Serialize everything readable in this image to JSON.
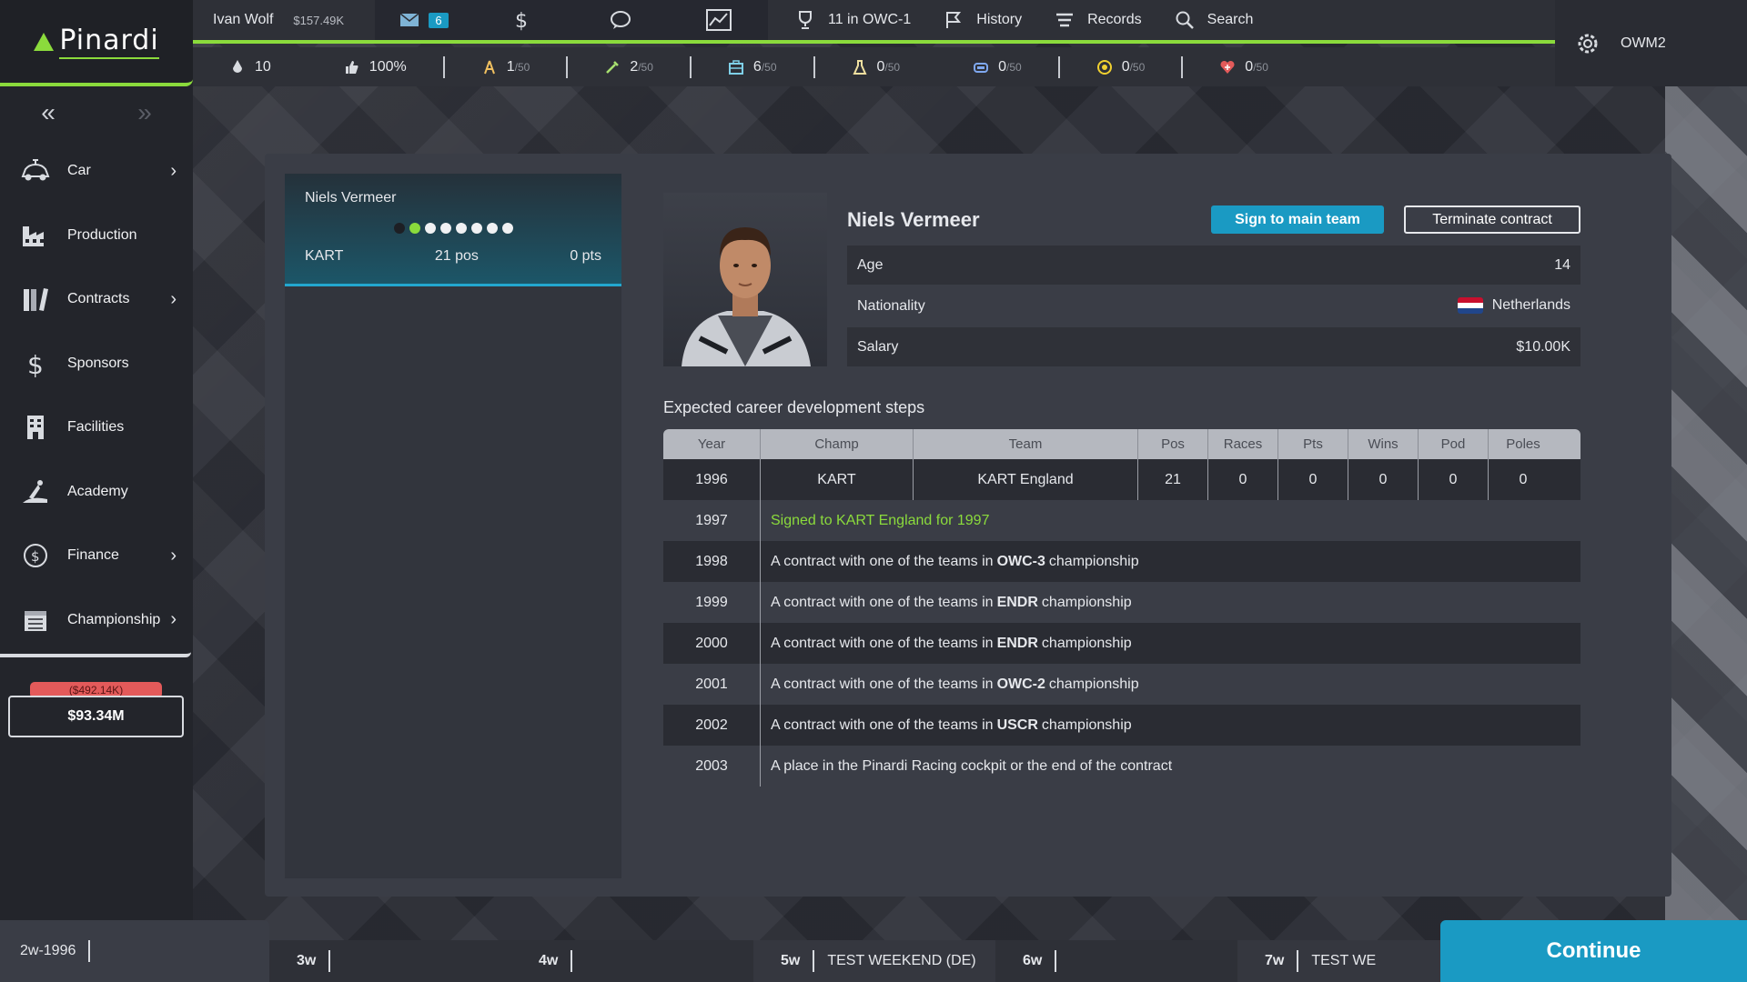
{
  "app": {
    "logo_text": "Pinardi"
  },
  "sidebar": {
    "collapse_left": "«",
    "collapse_right": "»",
    "items": [
      {
        "label": "Car",
        "icon": "car-icon",
        "has_submenu": true
      },
      {
        "label": "Production",
        "icon": "factory-icon",
        "has_submenu": false
      },
      {
        "label": "Contracts",
        "icon": "contracts-icon",
        "has_submenu": true
      },
      {
        "label": "Sponsors",
        "icon": "dollar-icon",
        "has_submenu": false
      },
      {
        "label": "Facilities",
        "icon": "building-icon",
        "has_submenu": false
      },
      {
        "label": "Academy",
        "icon": "academy-icon",
        "has_submenu": false
      },
      {
        "label": "Finance",
        "icon": "coin-icon",
        "has_submenu": true
      },
      {
        "label": "Championship",
        "icon": "calendar-icon",
        "has_submenu": true
      }
    ],
    "funds_delta": "($492.14K)",
    "funds": "$93.34M"
  },
  "topbar": {
    "user_name": "Ivan Wolf",
    "user_money": "$157.49K",
    "mail_count": "6",
    "championship": "11 in OWC-1",
    "history": "History",
    "records": "Records",
    "search": "Search",
    "right_user": "OWM2"
  },
  "stats": {
    "points": "10",
    "approval": "100%",
    "s1": "1",
    "s1_max": "/50",
    "s2": "2",
    "s2_max": "/50",
    "s3": "6",
    "s3_max": "/50",
    "s4": "0",
    "s4_max": "/50",
    "s5": "0",
    "s5_max": "/50",
    "s6": "0",
    "s6_max": "/50",
    "s7": "0",
    "s7_max": "/50"
  },
  "driver_card": {
    "name": "Niels Vermeer",
    "series": "KART",
    "pos": "21 pos",
    "pts": "0 pts",
    "rating_dots": [
      "k",
      "g",
      "w",
      "w",
      "w",
      "w",
      "w",
      "w"
    ]
  },
  "detail": {
    "name": "Niels Vermeer",
    "sign_button": "Sign to main team",
    "terminate_button": "Terminate contract",
    "age_label": "Age",
    "age_value": "14",
    "nationality_label": "Nationality",
    "nationality_value": "Netherlands",
    "salary_label": "Salary",
    "salary_value": "$10.00K",
    "flag_colors": [
      "#c8102e",
      "#ffffff",
      "#21468b"
    ]
  },
  "career": {
    "title": "Expected career development steps",
    "headers": [
      "Year",
      "Champ",
      "Team",
      "Pos",
      "Races",
      "Pts",
      "Wins",
      "Pod",
      "Poles"
    ],
    "first_row": [
      "1996",
      "KART",
      "KART England",
      "21",
      "0",
      "0",
      "0",
      "0",
      "0"
    ],
    "steps": [
      {
        "year": "1997",
        "pre": "Signed to KART England for 1997",
        "bold": "",
        "post": "",
        "green": true
      },
      {
        "year": "1998",
        "pre": "A contract with one of the teams in",
        "bold": "OWC-3",
        "post": "championship",
        "green": false
      },
      {
        "year": "1999",
        "pre": "A contract with one of the teams in",
        "bold": "ENDR",
        "post": "championship",
        "green": false
      },
      {
        "year": "2000",
        "pre": "A contract with one of the teams in",
        "bold": "ENDR",
        "post": "championship",
        "green": false
      },
      {
        "year": "2001",
        "pre": "A contract with one of the teams in",
        "bold": "OWC-2",
        "post": "championship",
        "green": false
      },
      {
        "year": "2002",
        "pre": "A contract with one of the teams in",
        "bold": "USCR",
        "post": "championship",
        "green": false
      },
      {
        "year": "2003",
        "pre": "A place in the Pinardi Racing cockpit or the end of the contract",
        "bold": "",
        "post": "",
        "green": false
      }
    ]
  },
  "timeline": {
    "current": "2w-1996",
    "weeks": [
      {
        "num": "3w",
        "event": ""
      },
      {
        "num": "4w",
        "event": ""
      },
      {
        "num": "5w",
        "event": "TEST WEEKEND (DE)"
      },
      {
        "num": "6w",
        "event": ""
      },
      {
        "num": "7w",
        "event": "TEST WE"
      }
    ],
    "continue": "Continue"
  }
}
